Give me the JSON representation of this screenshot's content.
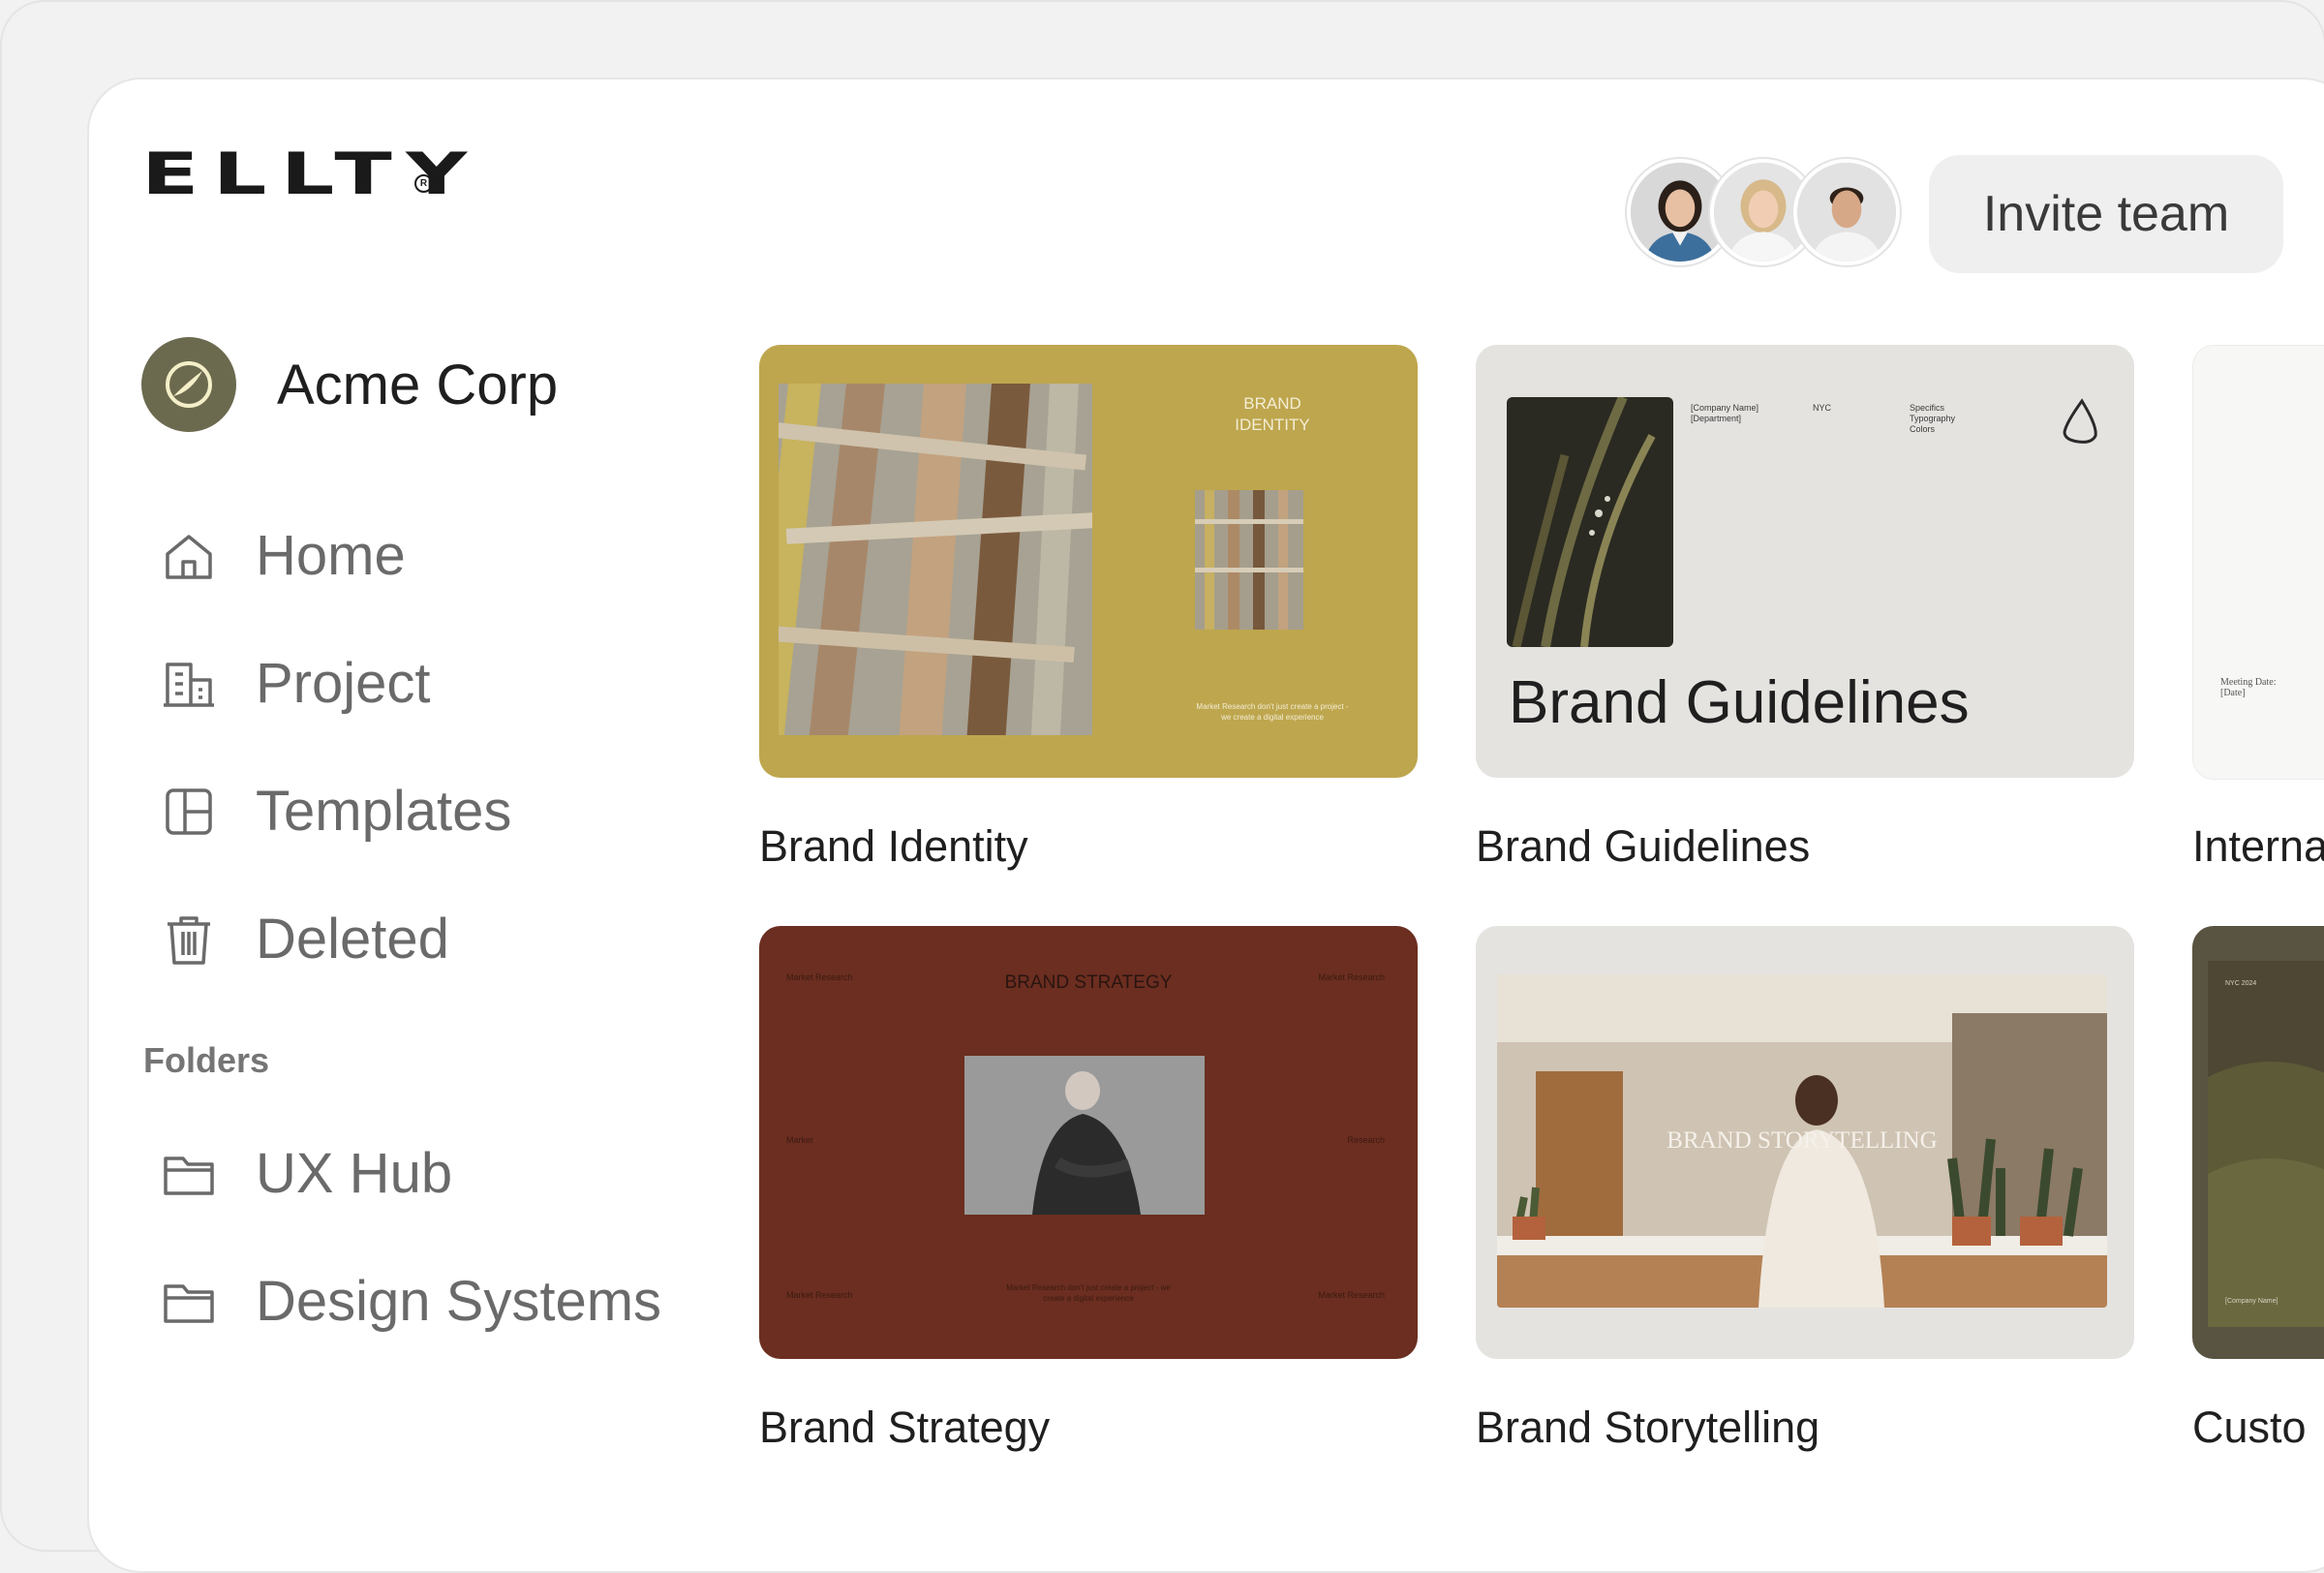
{
  "brand": {
    "logo_text": "ELLTY",
    "registered_mark": "R"
  },
  "header": {
    "invite_label": "Invite team"
  },
  "avatars": [
    {
      "icon": "avatar-woman-1",
      "bg": "#d6d6d6"
    },
    {
      "icon": "avatar-woman-2",
      "bg": "#e2e2e2"
    },
    {
      "icon": "avatar-man-1",
      "bg": "#e0e0e0"
    }
  ],
  "sidebar": {
    "org_name": "Acme Corp",
    "nav": [
      {
        "label": "Home",
        "icon": "home-icon"
      },
      {
        "label": "Project",
        "icon": "building-icon"
      },
      {
        "label": "Templates",
        "icon": "layout-icon"
      },
      {
        "label": "Deleted",
        "icon": "trash-icon"
      }
    ],
    "folders_label": "Folders",
    "folders": [
      {
        "label": "UX Hub",
        "icon": "folder-icon"
      },
      {
        "label": "Design Systems",
        "icon": "folder-icon"
      }
    ]
  },
  "cards": [
    {
      "title": "Brand Identity",
      "bg": "#bea64e",
      "inner_title_line1": "BRAND",
      "inner_title_line2": "IDENTITY",
      "inner_caption_line1": "Market Research don't just create a project -",
      "inner_caption_line2": "we create a digital experience"
    },
    {
      "title": "Brand Guidelines",
      "bg": "#e4e3e0",
      "inner_big_title": "Brand Guidelines",
      "meta_1a": "[Company Name]",
      "meta_1b": "[Department]",
      "meta_2": "NYC",
      "meta_3a": "Specifics",
      "meta_3b": "Typography",
      "meta_3c": "Colors"
    },
    {
      "title": "Interna",
      "bg": "#f7f7f5",
      "meta_a": "Meeting Date:",
      "meta_b": "[Date]"
    },
    {
      "title": "Brand Strategy",
      "bg": "#6b2e20",
      "inner_title": "BRAND STRATEGY",
      "corner": "Market Research",
      "side": "Market",
      "side_right": "Research",
      "inner_caption_line1": "Market Research don't just create a project - we",
      "inner_caption_line2": "create a digital experience"
    },
    {
      "title": "Brand Storytelling",
      "bg": "#e4e3e0",
      "inner_title": "BRAND STORYTELLING"
    },
    {
      "title": "Custo",
      "bg": "#595341",
      "meta_a": "NYC 2024",
      "meta_b": "[Company Name]"
    }
  ]
}
